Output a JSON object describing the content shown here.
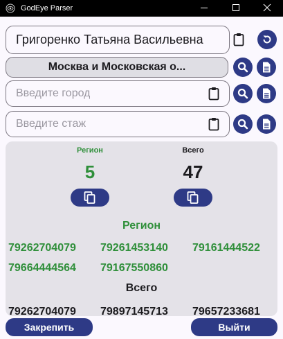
{
  "window": {
    "title": "GodEye Parser",
    "controls": [
      "minimize",
      "maximize",
      "close"
    ]
  },
  "name_field": {
    "value": "Григоренко Татьяна Васильевна",
    "icon": "clipboard-icon"
  },
  "region_select": {
    "value": "Москва и Московская о..."
  },
  "city_field": {
    "placeholder": "Введите город",
    "icon": "clipboard-icon"
  },
  "experience_field": {
    "placeholder": "Введите стаж",
    "icon": "clipboard-icon"
  },
  "stats": {
    "region_label": "Регион",
    "region_count": "5",
    "total_label": "Всего",
    "total_count": "47"
  },
  "results": {
    "region_title": "Регион",
    "region_phones": [
      "79262704079",
      "79261453140",
      "79161444522",
      "79664444564",
      "79167550860"
    ],
    "total_title": "Всего",
    "total_phones": [
      "79262704079",
      "79897145713",
      "79657233681"
    ]
  },
  "footer": {
    "pin_label": "Закрепить",
    "exit_label": "Выйти"
  },
  "colors": {
    "accent": "#2e3a86",
    "green": "#2f8f3a",
    "card": "#e4e2e8",
    "background": "#fbf8fe"
  }
}
